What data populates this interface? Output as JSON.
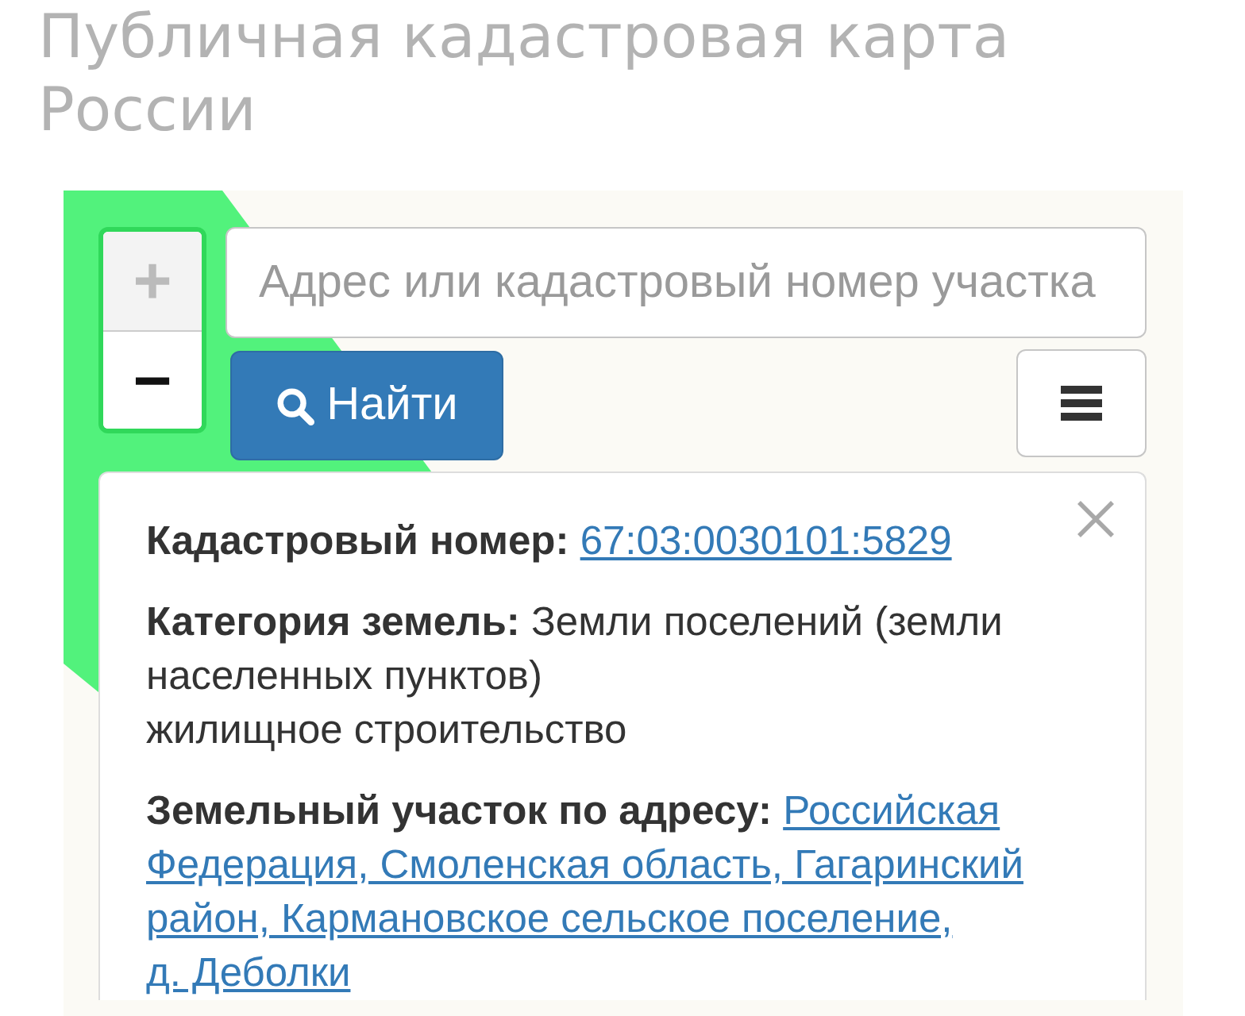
{
  "page": {
    "title": "Публичная кадастровая карта России"
  },
  "zoom_control": [
    {
      "label": "+",
      "disabled": true
    },
    {
      "label": "−",
      "disabled": false
    }
  ],
  "search": {
    "placeholder": "Адрес или кадастровый номер участка",
    "button": "Найти"
  },
  "popup": {
    "fields": [
      {
        "kind": "link",
        "label": "Кадастровый номер:",
        "lines": [
          "67:03:0030101:5829"
        ]
      },
      {
        "kind": "text",
        "label": "Категория земель:",
        "lines": [
          "Земли поселений (земли",
          "населенных пунктов)",
          "жилищное строительство"
        ]
      },
      {
        "kind": "link",
        "label": "Земельный участок по адресу:",
        "lines": [
          "Российская",
          "Федерация, Смоленская область, Гагаринский",
          "район, Кармановское сельское поселение,",
          "д. Деболки"
        ]
      }
    ]
  }
}
